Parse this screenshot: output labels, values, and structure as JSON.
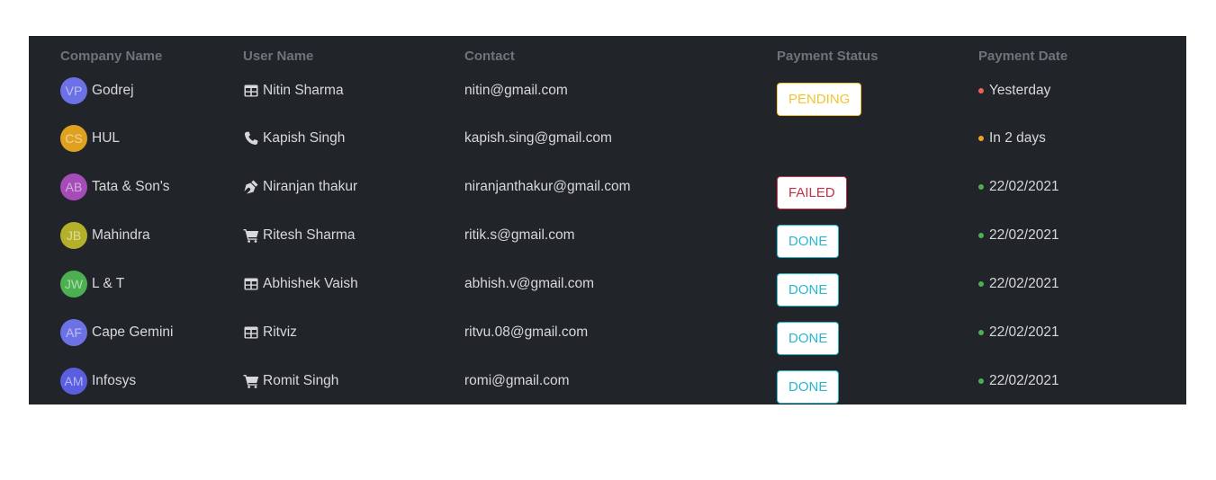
{
  "columns": {
    "company": "Company Name",
    "user": "User Name",
    "contact": "Contact",
    "status": "Payment Status",
    "date": "Payment Date"
  },
  "rows": [
    {
      "initials": "VP",
      "avatar_color": "#6d71e6",
      "company": "Godrej",
      "user_icon": "table-icon",
      "user": "Nitin Sharma",
      "contact": "nitin@gmail.com",
      "status": "PENDING",
      "status_color": "#f4c430",
      "date_dot_color": "#f06060",
      "date": "Yesterday"
    },
    {
      "initials": "CS",
      "avatar_color": "#e0a020",
      "company": "HUL",
      "user_icon": "phone-icon",
      "user": "Kapish Singh",
      "contact": "kapish.sing@gmail.com",
      "status": "",
      "status_color": "",
      "date_dot_color": "#f0a020",
      "date": "In 2 days"
    },
    {
      "initials": "AB",
      "avatar_color": "#a64cb8",
      "company": "Tata & Son's",
      "user_icon": "pen-nib-icon",
      "user": "Niranjan thakur",
      "contact": "niranjanthakur@gmail.com",
      "status": "FAILED",
      "status_color": "#c0314a",
      "date_dot_color": "#4caf50",
      "date": "22/02/2021"
    },
    {
      "initials": "JB",
      "avatar_color": "#b5b02a",
      "company": "Mahindra",
      "user_icon": "cart-icon",
      "user": "Ritesh Sharma",
      "contact": "ritik.s@gmail.com",
      "status": "DONE",
      "status_color": "#29b8cc",
      "date_dot_color": "#4caf50",
      "date": "22/02/2021"
    },
    {
      "initials": "JW",
      "avatar_color": "#4caf50",
      "company": "L & T",
      "user_icon": "table-icon",
      "user": "Abhishek Vaish",
      "contact": "abhish.v@gmail.com",
      "status": "DONE",
      "status_color": "#29b8cc",
      "date_dot_color": "#4caf50",
      "date": "22/02/2021"
    },
    {
      "initials": "AF",
      "avatar_color": "#6d71e6",
      "company": "Cape Gemini",
      "user_icon": "table-icon",
      "user": "Ritviz",
      "contact": "ritvu.08@gmail.com",
      "status": "DONE",
      "status_color": "#29b8cc",
      "date_dot_color": "#4caf50",
      "date": "22/02/2021"
    },
    {
      "initials": "AM",
      "avatar_color": "#5a5ee0",
      "company": "Infosys",
      "user_icon": "cart-icon",
      "user": "Romit Singh",
      "contact": "romi@gmail.com",
      "status": "DONE",
      "status_color": "#29b8cc",
      "date_dot_color": "#4caf50",
      "date": "22/02/2021"
    }
  ]
}
